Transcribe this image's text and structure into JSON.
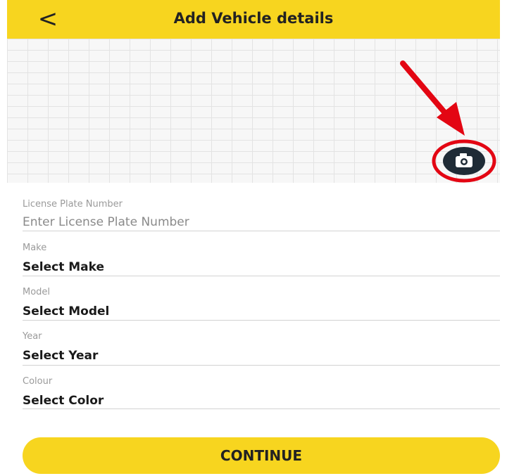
{
  "header": {
    "back_icon": "chevron-left-icon",
    "back_glyph": "<",
    "title": "Add Vehicle details"
  },
  "photo": {
    "camera_icon": "camera-icon",
    "annotation_color": "#e30613"
  },
  "form": {
    "license": {
      "label": "License Plate Number",
      "placeholder": "Enter License Plate Number"
    },
    "make": {
      "label": "Make",
      "value": "Select Make"
    },
    "model": {
      "label": "Model",
      "value": "Select Model"
    },
    "year": {
      "label": "Year",
      "value": "Select Year"
    },
    "colour": {
      "label": "Colour",
      "value": "Select Color"
    }
  },
  "continue_label": "CONTINUE",
  "colors": {
    "accent": "#f7d51f",
    "camera_button": "#1f2b36"
  }
}
